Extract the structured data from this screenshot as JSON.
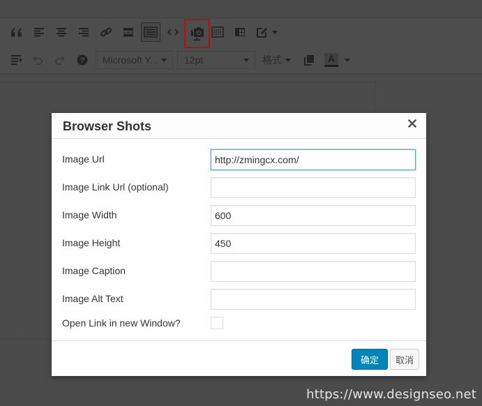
{
  "toolbar": {
    "row1": [
      {
        "name": "blockquote",
        "icon": "blockquote-icon"
      },
      {
        "name": "align-left",
        "icon": "align-left-icon"
      },
      {
        "name": "align-center",
        "icon": "align-center-icon"
      },
      {
        "name": "align-right",
        "icon": "align-right-icon"
      },
      {
        "name": "insert-link",
        "icon": "link-icon"
      },
      {
        "name": "read-more",
        "icon": "read-more-icon"
      },
      {
        "name": "toolbar-toggle",
        "icon": "keyboard-icon",
        "active": true
      },
      {
        "name": "code",
        "icon": "code-icon"
      },
      {
        "name": "browser-shots",
        "icon": "browser-shots-icon",
        "highlighted": true
      },
      {
        "name": "page-break",
        "icon": "page-break-icon"
      },
      {
        "name": "table",
        "icon": "table-icon"
      },
      {
        "name": "edit-dropdown",
        "icon": "edit-icon"
      }
    ],
    "row2": {
      "font_family": "Microsoft Y...",
      "font_size": "12pt",
      "format_label": "格式",
      "text_color_letter": "A"
    },
    "highlight_color": "#b50f0f"
  },
  "dialog": {
    "title": "Browser Shots",
    "close_symbol": "✕",
    "fields": [
      {
        "label": "Image Url",
        "value": "http://zmingcx.com/",
        "focused": true
      },
      {
        "label": "Image Link Url (optional)",
        "value": ""
      },
      {
        "label": "Image Width",
        "value": "600"
      },
      {
        "label": "Image Height",
        "value": "450"
      },
      {
        "label": "Image Caption",
        "value": ""
      },
      {
        "label": "Image Alt Text",
        "value": ""
      }
    ],
    "checkbox": {
      "label": "Open Link in new Window?",
      "checked": false
    },
    "ok_label": "确定",
    "cancel_label": "取消",
    "primary_color": "#0085ba"
  },
  "watermark": "https://www.designseo.net"
}
